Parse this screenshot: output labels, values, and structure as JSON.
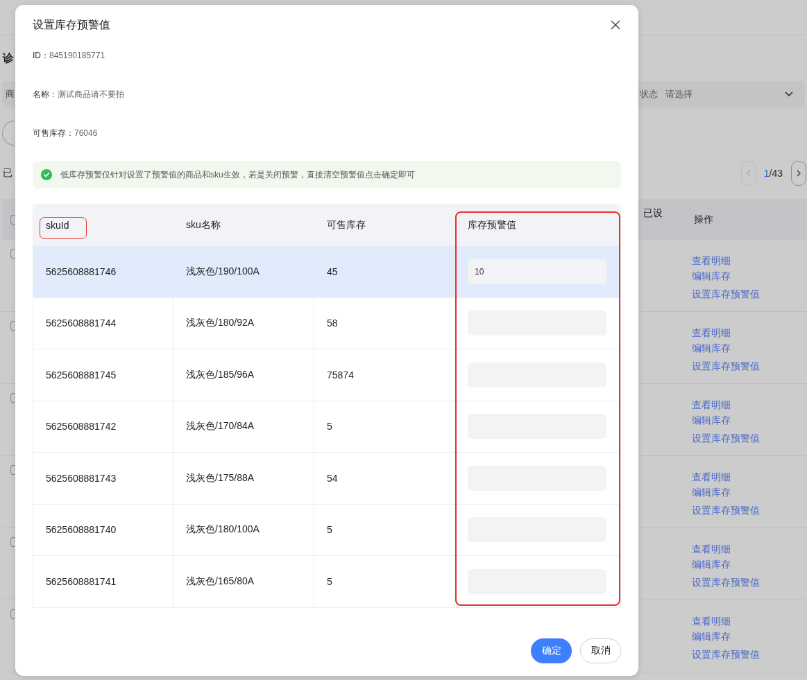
{
  "background_page": {
    "heading": "诊",
    "filter_bar": {
      "field_label": "商",
      "status_label": "状态",
      "status_placeholder": "请选择"
    },
    "selected_label": "已",
    "pagination": {
      "prev": {
        "disabled": true
      },
      "current": "1",
      "total": "/43",
      "next": {
        "disabled": false
      }
    },
    "table": {
      "header_checked": false,
      "columns": [
        "已设",
        "操作"
      ],
      "rows": [
        {
          "checked": false,
          "actions": [
            "查看明细",
            "编辑库存",
            "设置库存预警值"
          ]
        },
        {
          "checked": false,
          "actions": [
            "查看明细",
            "编辑库存",
            "设置库存预警值"
          ]
        },
        {
          "checked": false,
          "actions": [
            "查看明细",
            "编辑库存",
            "设置库存预警值"
          ]
        },
        {
          "checked": false,
          "actions": [
            "查看明细",
            "编辑库存",
            "设置库存预警值"
          ]
        },
        {
          "checked": false,
          "actions": [
            "查看明细",
            "编辑库存",
            "设置库存预警值"
          ]
        },
        {
          "checked": false,
          "actions": [
            "查看明细",
            "编辑库存",
            "设置库存预警值"
          ]
        }
      ]
    }
  },
  "dialog": {
    "title": "设置库存预警值",
    "info": [
      {
        "label": "ID：",
        "value": "845190185771"
      },
      {
        "label": "名称：",
        "value": "测试商品请不要拍"
      },
      {
        "label": "可售库存：",
        "value": "76046"
      }
    ],
    "notice": "低库存预警仅针对设置了预警值的商品和sku生效，若是关闭预警，直接清空预警值点击确定即可",
    "table": {
      "columns": [
        {
          "label": "skuId",
          "header_marked": true,
          "column_marked": false
        },
        {
          "label": "sku名称",
          "header_marked": false,
          "column_marked": false
        },
        {
          "label": "可售库存",
          "header_marked": false,
          "column_marked": false
        },
        {
          "label": "库存预警值",
          "header_marked": false,
          "column_marked": true
        }
      ],
      "rows": [
        {
          "sku_id": "5625608881746",
          "sku_name": "浅灰色/190/100A",
          "stock": "45",
          "threshold": "10",
          "highlighted": true
        },
        {
          "sku_id": "5625608881744",
          "sku_name": "浅灰色/180/92A",
          "stock": "58",
          "highlighted": false
        },
        {
          "sku_id": "5625608881745",
          "sku_name": "浅灰色/185/96A",
          "stock": "75874",
          "highlighted": false
        },
        {
          "sku_id": "5625608881742",
          "sku_name": "浅灰色/170/84A",
          "stock": "5",
          "highlighted": false
        },
        {
          "sku_id": "5625608881743",
          "sku_name": "浅灰色/175/88A",
          "stock": "54",
          "highlighted": false
        },
        {
          "sku_id": "5625608881740",
          "sku_name": "浅灰色/180/100A",
          "stock": "5",
          "highlighted": false
        },
        {
          "sku_id": "5625608881741",
          "sku_name": "浅灰色/165/80A",
          "stock": "5",
          "highlighted": false
        }
      ]
    },
    "buttons": [
      {
        "label": "确定",
        "kind": "primary"
      },
      {
        "label": "取消",
        "kind": "secondary"
      }
    ]
  }
}
